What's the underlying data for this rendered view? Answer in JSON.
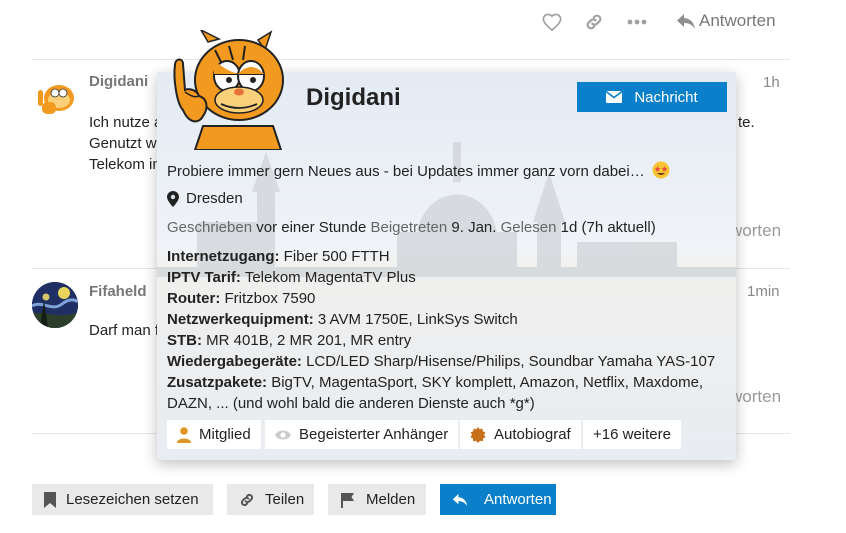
{
  "topbar": {
    "reply_label": "Antworten"
  },
  "posts": [
    {
      "author": "Digidani",
      "time": "1h",
      "lines": [
        "Ich nutze a",
        "Genutzt w",
        "Telekom in"
      ],
      "right_fragment": "te.",
      "reply_faded": "worten"
    },
    {
      "author": "Fifaheld",
      "time": "1min",
      "lines": [
        "Darf man f"
      ],
      "reply_faded": "worten"
    }
  ],
  "card": {
    "username": "Digidani",
    "message_button": "Nachricht",
    "bio": "Probiere immer gern Neues aus - bei Updates immer ganz vorn dabei…",
    "location": "Dresden",
    "stats": {
      "written_label": "Geschrieben",
      "written_value": "vor einer Stunde",
      "joined_label": "Beigetreten",
      "joined_value": "9. Jan.",
      "read_label": "Gelesen",
      "read_value": "1d (7h aktuell)"
    },
    "fields": [
      {
        "label": "Internetzugang:",
        "value": "Fiber 500 FTTH"
      },
      {
        "label": "IPTV Tarif:",
        "value": "Telekom MagentaTV Plus"
      },
      {
        "label": "Router:",
        "value": "Fritzbox 7590"
      },
      {
        "label": "Netzwerkequipment:",
        "value": "3 AVM 1750E, LinkSys Switch"
      },
      {
        "label": "STB:",
        "value": "MR 401B, 2 MR 201, MR entry"
      },
      {
        "label": "Wiedergabegeräte:",
        "value": "LCD/LED Sharp/Hisense/Philips, Soundbar Yamaha YAS-107"
      },
      {
        "label": "Zusatzpakete:",
        "value": "BigTV, MagentaSport, SKY komplett, Amazon, Netflix, Maxdome,"
      }
    ],
    "fields_continuation": "DAZN, ... (und wohl bald die anderen Dienste auch *g*)",
    "badges": [
      "Mitglied",
      "Begeisterter Anhänger",
      "Autobiograf",
      "+16 weitere"
    ]
  },
  "actions": {
    "bookmark": "Lesezeichen setzen",
    "share": "Teilen",
    "flag": "Melden",
    "reply": "Antworten"
  },
  "colors": {
    "accent": "#0a7fca",
    "badge_orange": "#e09526",
    "muted": "#919191"
  }
}
